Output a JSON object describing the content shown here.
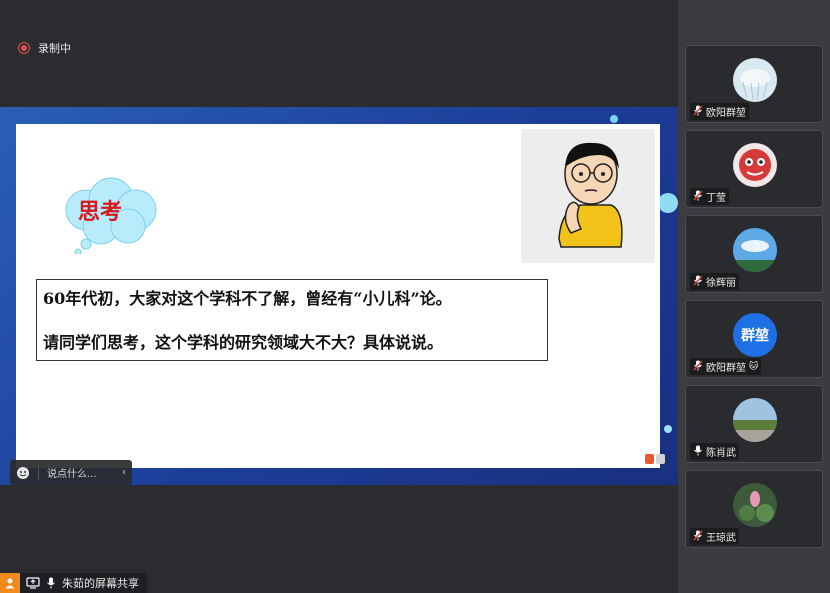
{
  "recording": {
    "label": "录制中"
  },
  "slide": {
    "thought_bubble": "思考",
    "line1": "60年代初，大家对这个学科不了解，曾经有“小儿科”论。",
    "line2": "请同学们思考，这个学科的研究领域大不大？具体说说。"
  },
  "chat": {
    "placeholder": "说点什么..."
  },
  "share": {
    "label": "朱茹的屏幕共享"
  },
  "participants": [
    {
      "name": "欧阳群堃",
      "mic": "muted",
      "avatar": "jellyfish-photo"
    },
    {
      "name": "丁莹",
      "mic": "muted",
      "avatar": "lion-dance-photo"
    },
    {
      "name": "徐辉丽",
      "mic": "muted",
      "avatar": "sky-photo"
    },
    {
      "name": "欧阳群堃",
      "mic": "muted",
      "avatar_text": "群堃"
    },
    {
      "name": "陈肖武",
      "mic": "on",
      "avatar": "landscape-photo"
    },
    {
      "name": "王琼武",
      "mic": "muted",
      "avatar": "lotus-photo"
    }
  ],
  "colors": {
    "accent": "#1f6fe5",
    "record": "#e05050",
    "share_badge": "#f08a1c"
  }
}
